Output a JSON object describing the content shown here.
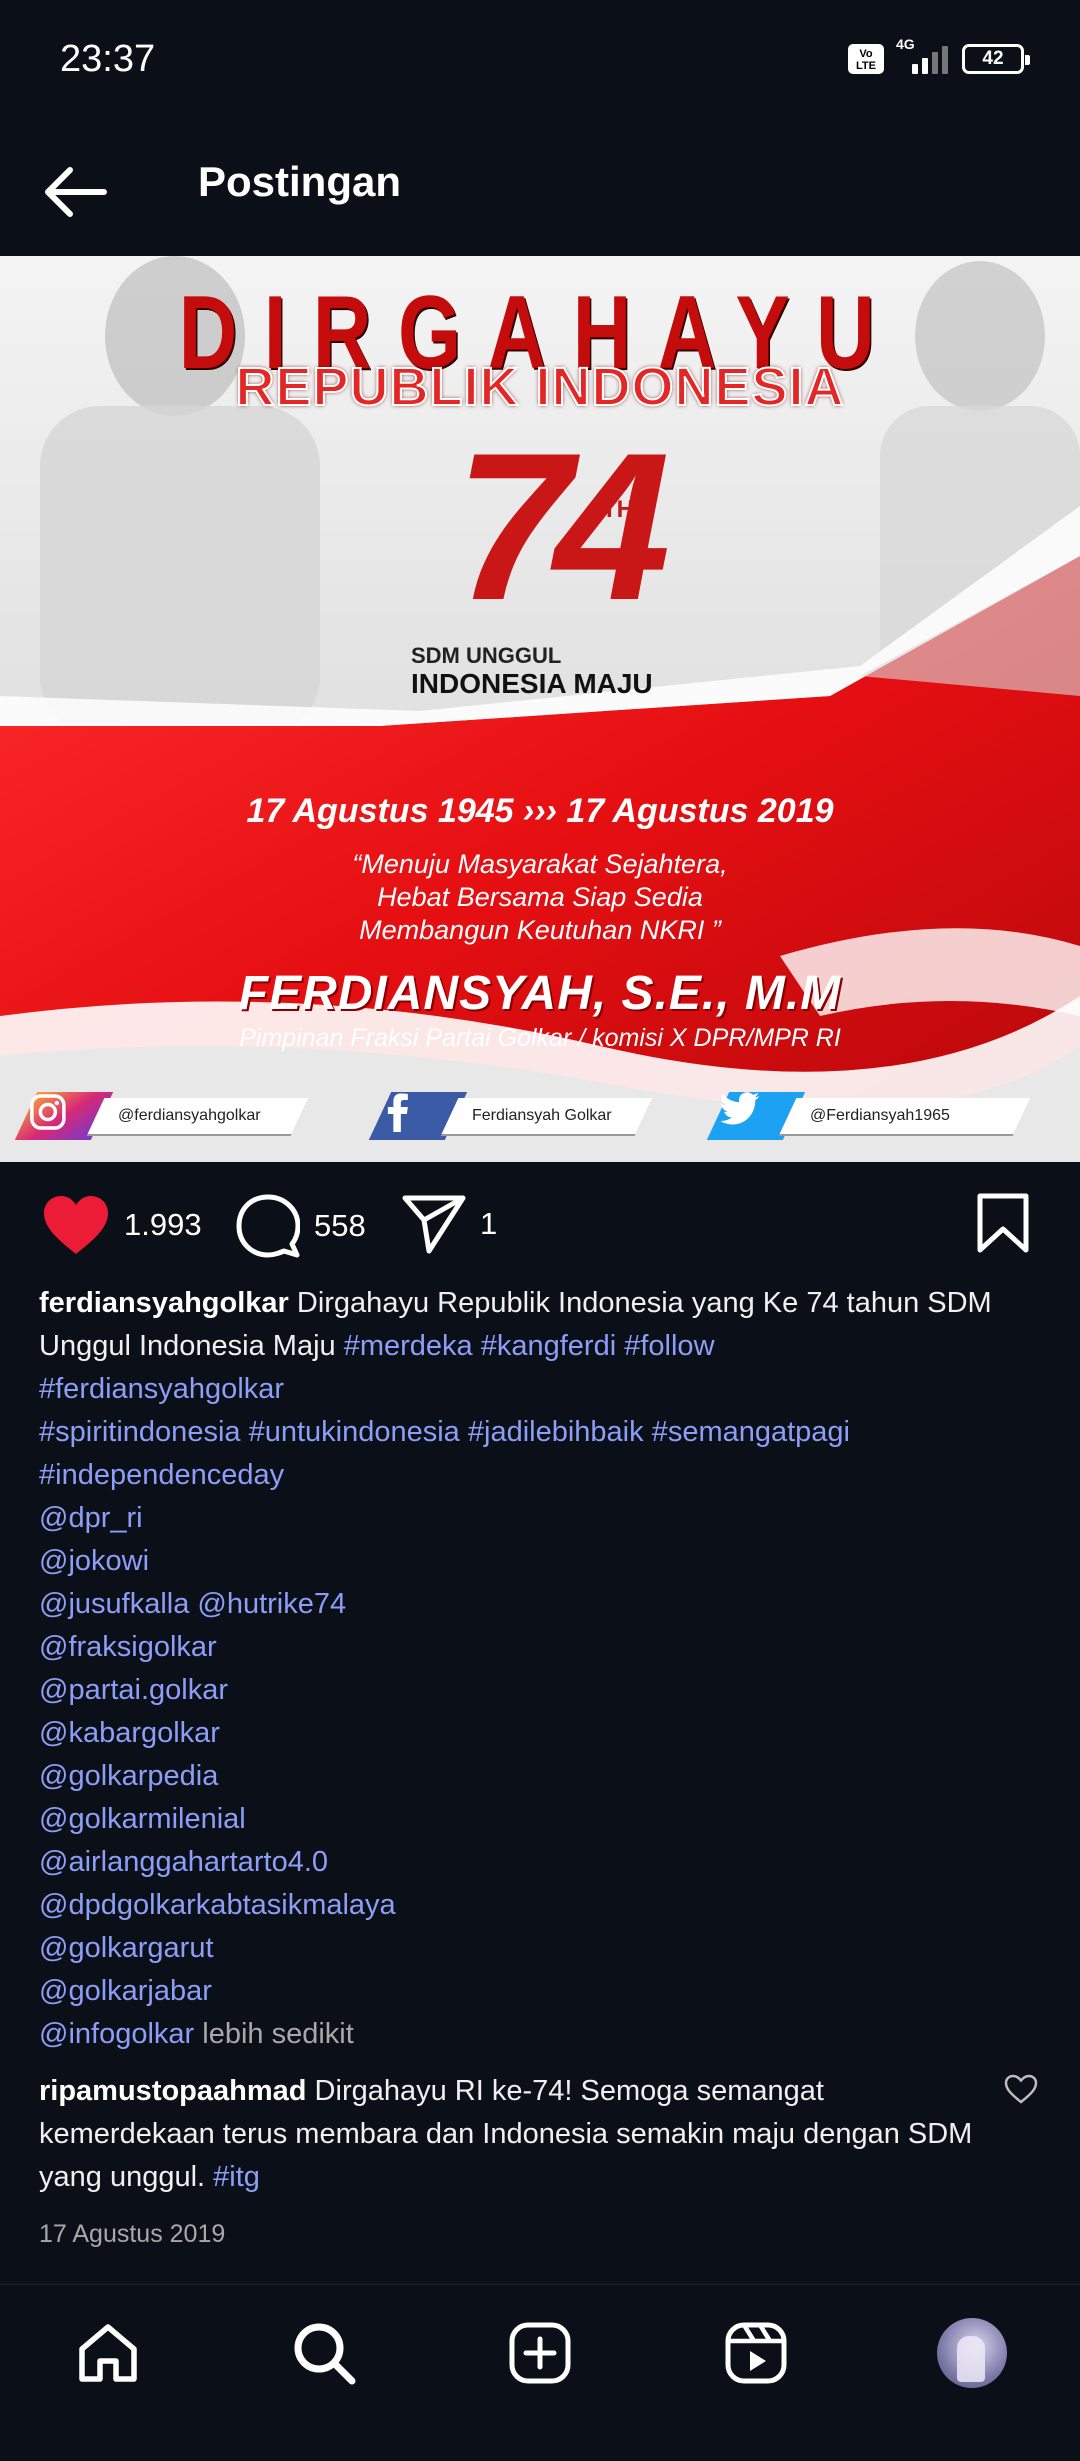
{
  "status": {
    "time": "23:37",
    "volte": "Vo LTE",
    "network": "4G",
    "battery": "42"
  },
  "header": {
    "title": "Postingan"
  },
  "post_image": {
    "headline": "DIRGAHAYU",
    "subheadline": "REPUBLIK INDONESIA",
    "number": "74",
    "number_suffix": "TH",
    "slogan_line1": "SDM UNGGUL",
    "slogan_line2": "INDONESIA MAJU",
    "dates": "17 Agustus 1945  ›››  17 Agustus 2019",
    "quote_line1": "“Menuju Masyarakat Sejahtera,",
    "quote_line2": "Hebat Bersama Siap Sedia",
    "quote_line3": "Membangun Keutuhan NKRI ”",
    "name": "FERDIANSYAH, S.E., M.M",
    "role": "Pimpinan Fraksi Partai Golkar / komisi X DPR/MPR RI",
    "instagram_handle": "@ferdiansyahgolkar",
    "facebook_handle": "Ferdiansyah Golkar",
    "twitter_handle": "@Ferdiansyah1965"
  },
  "actions": {
    "likes": "1.993",
    "comments": "558",
    "shares": "1"
  },
  "caption": {
    "username": "ferdiansyahgolkar",
    "text": " Dirgahayu Republik Indonesia yang Ke 74 tahun SDM Unggul Indonesia Maju ",
    "hashtags_line1": [
      "#merdeka",
      "#kangferdi",
      "#follow"
    ],
    "hashtags_line2": "#ferdiansyahgolkar",
    "hashtags_line3": [
      "#spiritindonesia",
      "#untukindonesia",
      "#jadilebihbaik",
      "#semangatpagi"
    ],
    "hashtags_line4": "#independenceday",
    "mentions": [
      "@dpr_ri",
      "@jokowi",
      "@jusufkalla @hutrike74",
      "@fraksigolkar",
      "@partai.golkar",
      "@kabargolkar",
      "@golkarpedia",
      "@golkarmilenial",
      "@airlanggahartarto4.0",
      "@dpdgolkarkabtasikmalaya",
      "@golkargarut",
      "@golkarjabar"
    ],
    "last_mention": "@infogolkar",
    "less_label": "lebih sedikit"
  },
  "comment": {
    "username": "ripamustopaahmad",
    "text": " Dirgahayu RI ke-74! Semoga semangat kemerdekaan terus membara dan Indonesia semakin maju dengan SDM yang unggul. ",
    "hashtag": "#itg"
  },
  "post_date": "17 Agustus 2019",
  "colors": {
    "background": "#0b0f17",
    "link": "#8c9ef7",
    "like": "#ed1c36",
    "brand_red": "#c91616"
  },
  "nav": [
    "home-icon",
    "search-icon",
    "add-post-icon",
    "reels-icon",
    "profile-avatar"
  ]
}
